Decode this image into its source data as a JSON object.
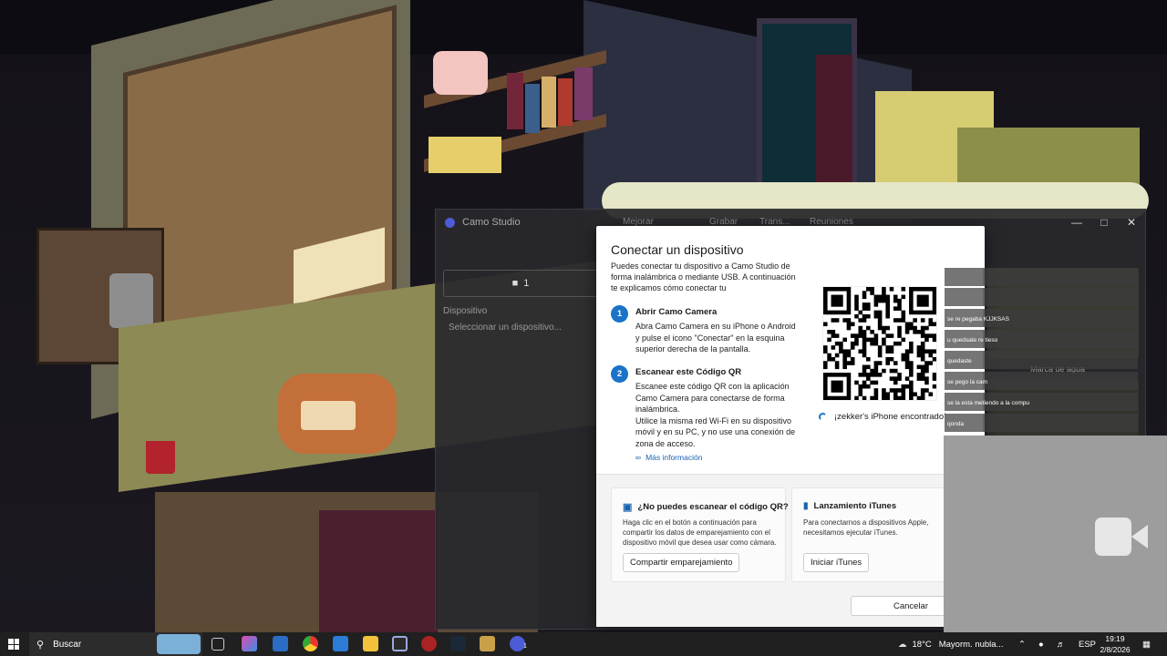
{
  "camo_window": {
    "title": "Camo Studio",
    "toolbar": [
      "Mejorar",
      "Grabar",
      "Trans...",
      "Reuniones"
    ],
    "panel_button": "1",
    "device_label": "Dispositivo",
    "device_placeholder": "Seleccionar un dispositivo...",
    "watermark": "Marca de agua",
    "controls": {
      "minimize": "—",
      "maximize": "□",
      "close": "✕"
    }
  },
  "dialog": {
    "title": "Conectar un dispositivo",
    "intro": "Puedes conectar tu dispositivo a Camo Studio de forma inalámbrica o mediante USB. A continuación te explicamos cómo conectar tu",
    "steps": [
      {
        "num": "1",
        "title": "Abrir Camo Camera",
        "body": "Abra Camo Camera en su iPhone o Android y pulse el icono \"Conectar\" en la esquina superior derecha de la pantalla."
      },
      {
        "num": "2",
        "title": "Escanear este Código QR",
        "body": "Escanee este código QR con la aplicación Camo Camera para conectarse de forma inalámbrica.",
        "body2": "Utilice la misma red Wi-Fi en su dispositivo móvil y en su PC, y no use una conexión de zona de acceso."
      }
    ],
    "more_info": "Más información",
    "found_device": "¡zekker's iPhone encontrado!",
    "card_qr": {
      "title": "¿No puedes escanear el código QR?",
      "body": "Haga clic en el botón a continuación para compartir los datos de emparejamiento con el dispositivo móvil que desea usar como cámara.",
      "button": "Compartir emparejamiento"
    },
    "card_itunes": {
      "title": "Lanzamiento iTunes",
      "body": "Para conectarnos a dispositivos Apple, necesitamos ejecutar iTunes.",
      "button": "Iniciar iTunes"
    },
    "cancel": "Cancelar"
  },
  "chat": [
    {
      "user": "",
      "text": ""
    },
    {
      "user": "",
      "text": ""
    },
    {
      "user": "",
      "text": "se re pegaba KJJKSAS"
    },
    {
      "user": "",
      "text": "u quedsate re tieso"
    },
    {
      "user": "",
      "text": "quedaste"
    },
    {
      "user": "",
      "text": "se pego la cam"
    },
    {
      "user": "",
      "text": "se la esta metiendo a la compu"
    },
    {
      "user": "",
      "text": "qonda"
    }
  ],
  "taskbar": {
    "search": "Buscar",
    "weather_temp": "18°C",
    "weather_text": "Mayorm. nubla...",
    "lang": "ESP",
    "time": "19:19",
    "date": "2/8/2026",
    "badge": "1"
  },
  "colors": {
    "accent": "#1a73c8",
    "taskbar": "#202020"
  }
}
